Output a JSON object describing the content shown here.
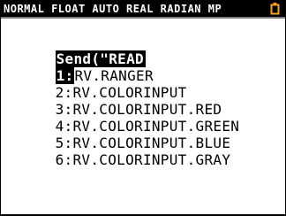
{
  "status_bar": {
    "text": "NORMAL FLOAT AUTO REAL RADIAN MP",
    "battery_icon": "battery-icon",
    "colors": {
      "background": "#000000",
      "text": "#ffffff",
      "battery": "#f7a21b"
    }
  },
  "menu": {
    "title": "Send(\"READ",
    "items": [
      {
        "num": "1:",
        "label": "RV.RANGER",
        "selected": true
      },
      {
        "num": "2:",
        "label": "RV.COLORINPUT",
        "selected": false
      },
      {
        "num": "3:",
        "label": "RV.COLORINPUT.RED",
        "selected": false
      },
      {
        "num": "4:",
        "label": "RV.COLORINPUT.GREEN",
        "selected": false
      },
      {
        "num": "5:",
        "label": "RV.COLORINPUT.BLUE",
        "selected": false
      },
      {
        "num": "6:",
        "label": "RV.COLORINPUT.GRAY",
        "selected": false
      }
    ]
  }
}
